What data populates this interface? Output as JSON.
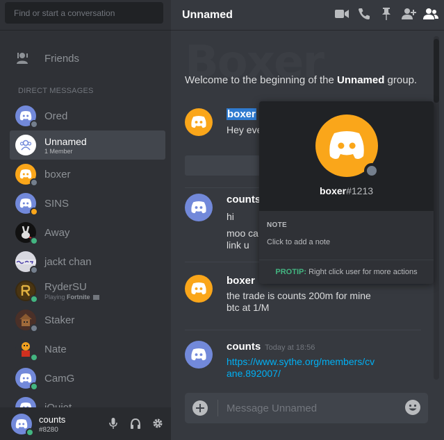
{
  "sidebar": {
    "search_placeholder": "Find or start a conversation",
    "friends_label": "Friends",
    "dm_header": "DIRECT MESSAGES",
    "dms": [
      {
        "name": "Ored",
        "sub": "",
        "avatar": "discord-blurple",
        "status": "offline"
      },
      {
        "name": "Unnamed",
        "sub": "1 Member",
        "avatar": "group-icon",
        "status": "none",
        "active": true
      },
      {
        "name": "boxer",
        "sub": "",
        "avatar": "discord-orange",
        "status": "offline"
      },
      {
        "name": "SINS",
        "sub": "",
        "avatar": "discord-blurple",
        "status": "idle"
      },
      {
        "name": "Away",
        "sub": "",
        "avatar": "photo",
        "status": "online"
      },
      {
        "name": "jackt chan",
        "sub": "",
        "avatar": "photo",
        "status": "offline"
      },
      {
        "name": "RyderSU",
        "sub_prefix": "Playing",
        "sub_game": "Fortnite",
        "avatar": "photo",
        "status": "online"
      },
      {
        "name": "Staker",
        "sub": "",
        "avatar": "photo",
        "status": "offline"
      },
      {
        "name": "Nate",
        "sub": "",
        "avatar": "photo",
        "status": "online"
      },
      {
        "name": "CamG",
        "sub": "",
        "avatar": "discord-blurple",
        "status": "online"
      },
      {
        "name": "iQuiet",
        "sub": "",
        "avatar": "discord-blurple",
        "status": "online"
      }
    ]
  },
  "user_panel": {
    "username": "counts",
    "discriminator": "#8280"
  },
  "header": {
    "title": "Unnamed"
  },
  "chat": {
    "watermark": "Boxer",
    "welcome_prefix": "Welcome to the beginning of the ",
    "welcome_group": "Unnamed",
    "welcome_suffix": " group.",
    "messages": [
      {
        "author": "boxer",
        "time": "",
        "lines": [
          "Hey eve"
        ]
      },
      {
        "author": "counts",
        "time": "",
        "lines": [
          "hi",
          "moo ca",
          "link u"
        ]
      },
      {
        "author": "boxer",
        "time": "",
        "lines": [
          "the trade is counts 200m for mine",
          "btc at 1/M"
        ]
      },
      {
        "author": "counts",
        "time": "Today at 18:56",
        "lines": [
          "https://www.sythe.org/members/cv",
          "ane.892007/"
        ]
      }
    ],
    "composer_placeholder": "Message Unnamed"
  },
  "popout": {
    "username": "boxer",
    "discriminator": "#1213",
    "note_header": "NOTE",
    "note_placeholder": "Click to add a note",
    "protip_label": "PROTIP:",
    "protip_text": " Right click user for more actions"
  },
  "colors": {
    "blurple": "#7289da",
    "orange": "#faa61a",
    "online": "#43b581",
    "offline": "#747f8d"
  }
}
